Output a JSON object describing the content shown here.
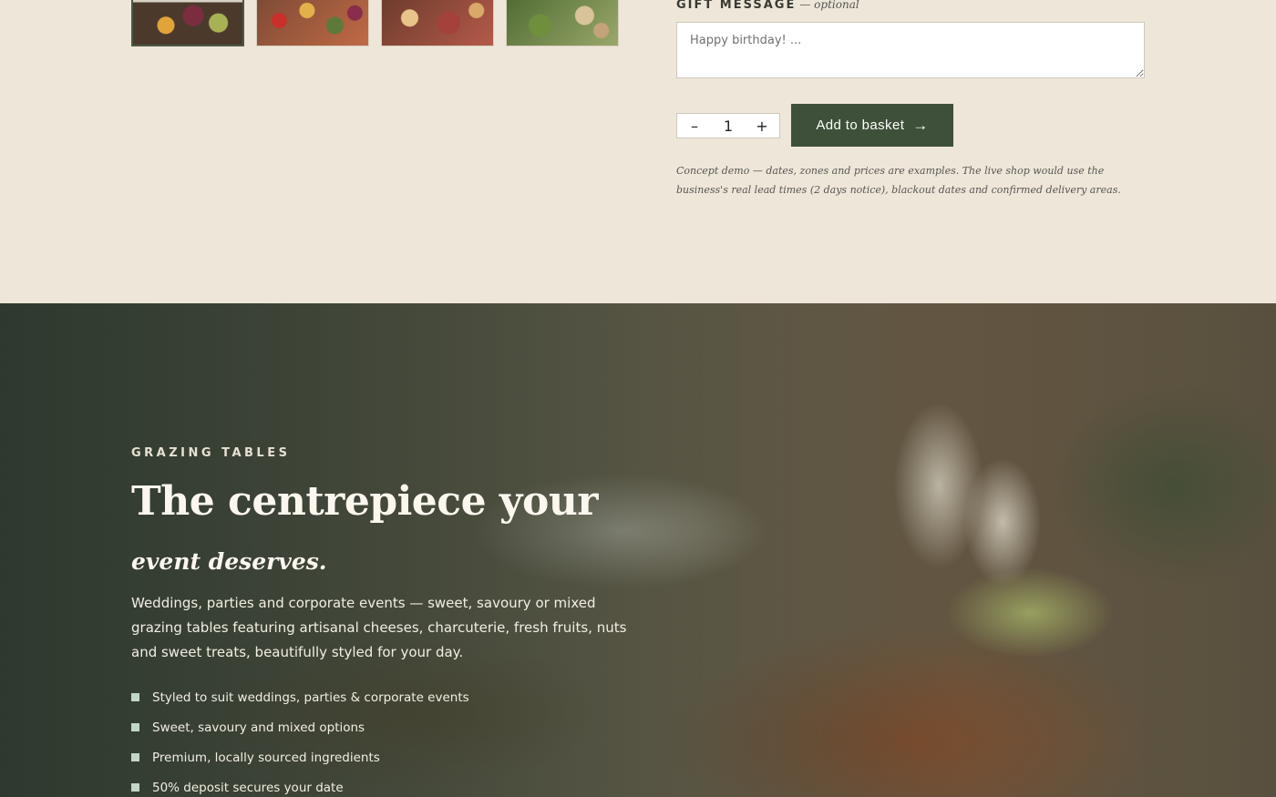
{
  "gift": {
    "label": "GIFT MESSAGE",
    "optional": "— optional",
    "placeholder": "Happy birthday! ..."
  },
  "stepper": {
    "minus": "–",
    "quantity": "1",
    "plus": "+"
  },
  "cart": {
    "add_label": "Add to basket",
    "arrow": "→"
  },
  "note": "Concept demo — dates, zones and prices are examples. The live shop would use the business's real lead times (2 days notice), blackout dates and confirmed delivery areas.",
  "hero": {
    "eyebrow": "GRAZING TABLES",
    "headline_main": "The centrepiece your",
    "headline_italic": "event deserves.",
    "lead": "Weddings, parties and corporate events — sweet, savoury or mixed grazing tables featuring artisanal cheeses, charcuterie, fresh fruits, nuts and sweet treats, beautifully styled for your day.",
    "bullets": [
      "Styled to suit weddings, parties & corporate events",
      "Sweet, savoury and mixed options",
      "Premium, locally sourced ingredients",
      "50% deposit secures your date"
    ]
  },
  "colors": {
    "background": "#eee6d8",
    "accent": "#3e5039",
    "bullet": "#c3d6c6"
  }
}
